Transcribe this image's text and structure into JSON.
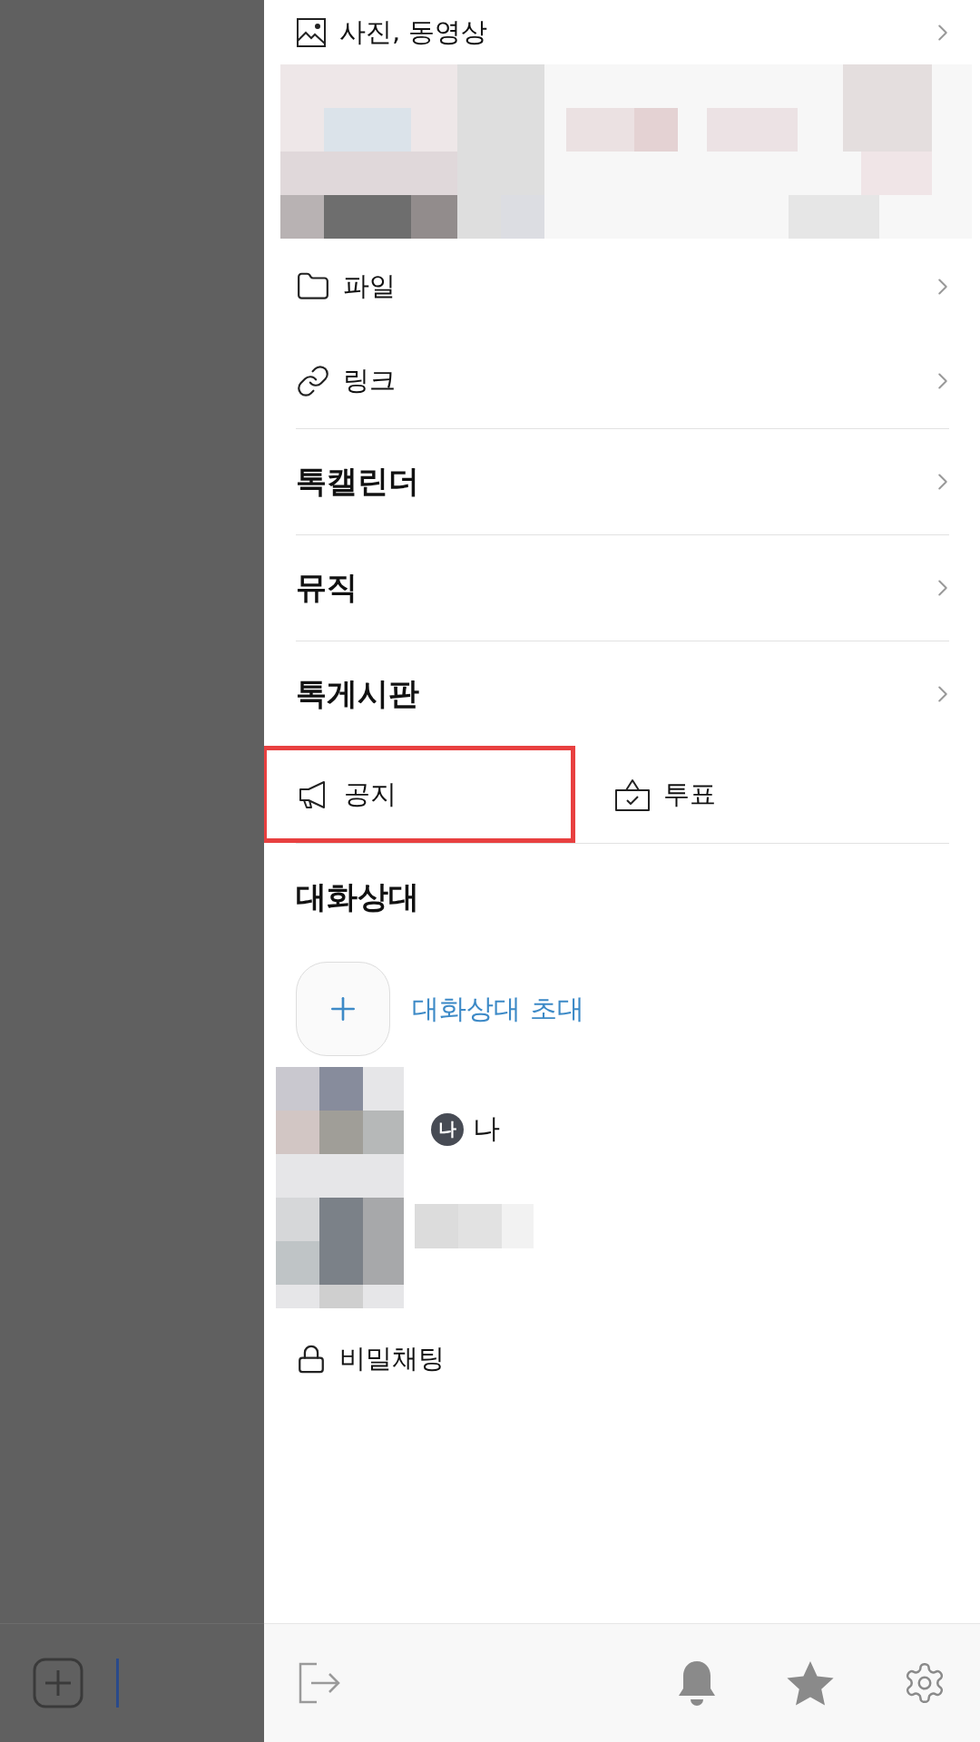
{
  "media": {
    "title": "사진, 동영상"
  },
  "menu": [
    {
      "kind": "file",
      "label": "파일"
    },
    {
      "kind": "link",
      "label": "링크"
    }
  ],
  "sections": [
    {
      "label": "톡캘린더"
    },
    {
      "label": "뮤직"
    },
    {
      "label": "톡게시판"
    }
  ],
  "board_actions": [
    {
      "kind": "notice",
      "label": "공지",
      "highlighted": true
    },
    {
      "kind": "vote",
      "label": "투표",
      "highlighted": false
    }
  ],
  "members": {
    "title": "대화상대",
    "invite": {
      "label": "대화상대 초대"
    },
    "list": [
      {
        "badge": "나",
        "name": "나"
      }
    ]
  },
  "secret_chat": {
    "label": "비밀채팅"
  }
}
